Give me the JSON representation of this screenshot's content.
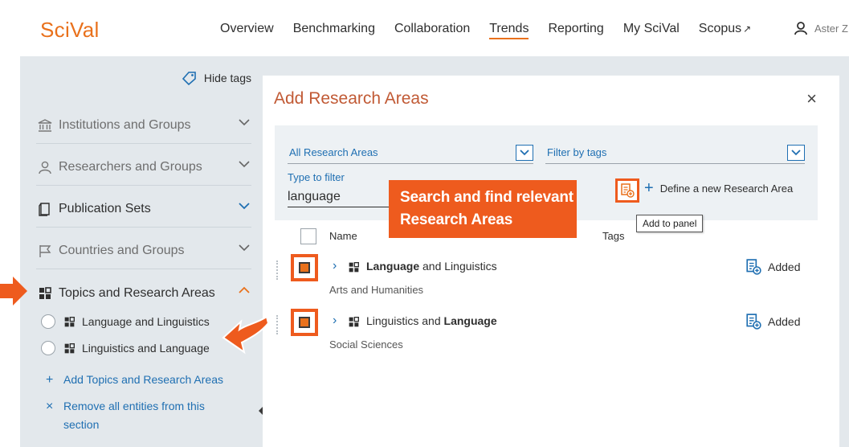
{
  "app": {
    "logo": "SciVal",
    "nav": [
      {
        "label": "Overview",
        "active": false
      },
      {
        "label": "Benchmarking",
        "active": false
      },
      {
        "label": "Collaboration",
        "active": false
      },
      {
        "label": "Trends",
        "active": true
      },
      {
        "label": "Reporting",
        "active": false
      },
      {
        "label": "My SciVal",
        "active": false
      },
      {
        "label": "Scopus",
        "active": false
      }
    ],
    "external_icon": "↗",
    "user_name": "Aster Z",
    "accent_color": "#e9711c"
  },
  "sidebar": {
    "hide_tags_label": "Hide tags",
    "sections": [
      {
        "label": "Institutions and Groups",
        "icon": "institution-icon",
        "expanded": false
      },
      {
        "label": "Researchers and Groups",
        "icon": "person-icon",
        "expanded": false
      },
      {
        "label": "Publication Sets",
        "icon": "document-icon",
        "expanded": false
      },
      {
        "label": "Countries and Groups",
        "icon": "flag-icon",
        "expanded": false
      },
      {
        "label": "Topics and Research Areas",
        "icon": "grid-icon",
        "expanded": true
      }
    ],
    "topic_items": [
      {
        "label": "Language and Linguistics"
      },
      {
        "label": "Linguistics and Language"
      }
    ],
    "add_link": "Add Topics and Research Areas",
    "remove_link_line1": "Remove all entities from this",
    "remove_link_line2": "section"
  },
  "modal": {
    "title": "Add Research Areas",
    "close_icon": "×",
    "area_select": "All Research Areas",
    "tags_select": "Filter by tags",
    "filter_label": "Type to filter",
    "filter_value": "language",
    "define_link": "Define a new Research Area",
    "tooltip": "Add to panel",
    "columns": {
      "name": "Name",
      "tags": "Tags"
    },
    "rows": [
      {
        "name_bold": "Language",
        "name_rest": " and Linguistics",
        "bold_first": true,
        "category": "Arts and Humanities",
        "status": "Added"
      },
      {
        "name_bold": "Language",
        "name_rest": "Linguistics and ",
        "bold_first": false,
        "category": "Social Sciences",
        "status": "Added"
      }
    ]
  },
  "annotation": {
    "callout_line1": "Search and find relevant",
    "callout_line2": "Research Areas",
    "highlight_color": "#ee5b1e"
  }
}
